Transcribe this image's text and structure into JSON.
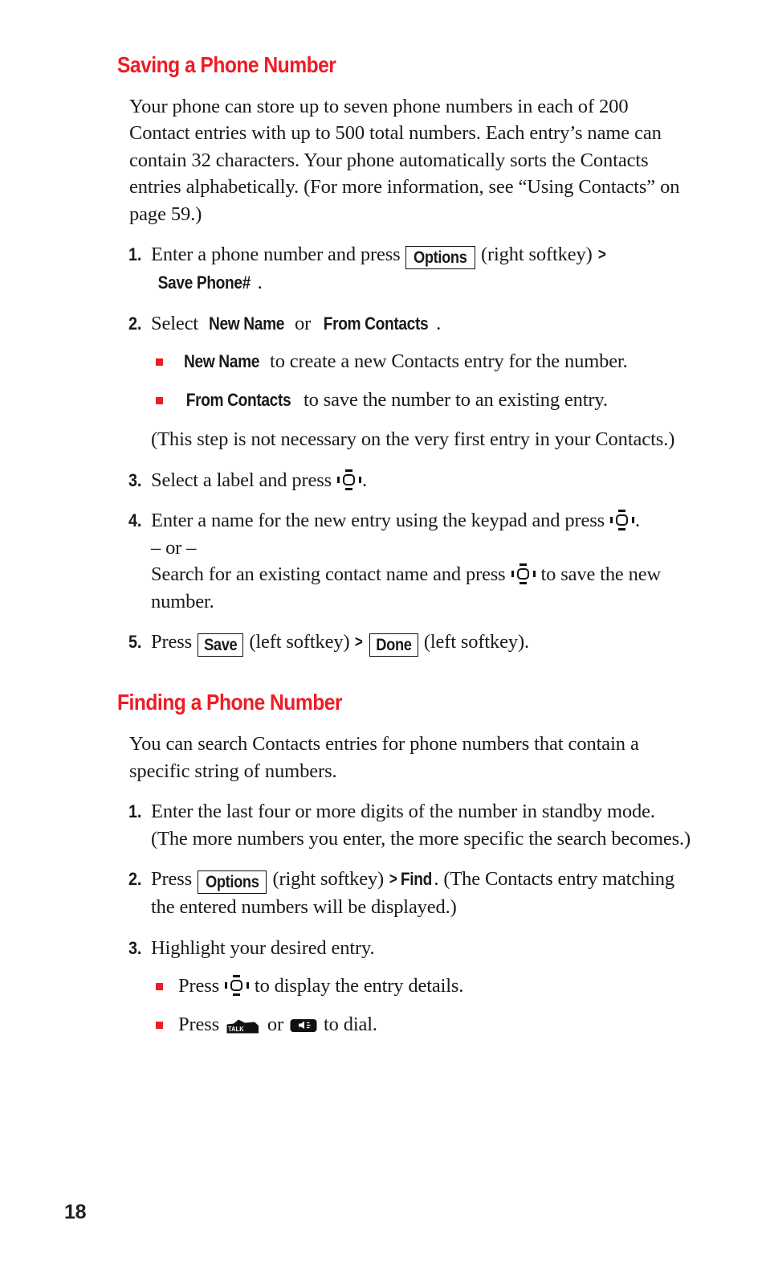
{
  "page": {
    "number": "18",
    "accent_color": "#ee1c25",
    "text_color": "#1a1a1a"
  },
  "sections": [
    {
      "heading": "Saving a Phone Number",
      "intro": "Your phone can store up to seven phone numbers in each of 200 Contact entries with up to 500 total numbers. Each entry’s name can contain 32 characters. Your phone automatically sorts the Contacts entries alphabetically. (For more information, see “Using Contacts” on page 59.)",
      "steps": [
        {
          "num": "1.",
          "t1": "Enter a phone number and press ",
          "softkey": "Options",
          "t2": " (right softkey) ",
          "arrow": ">",
          "bold_target": "Save Phone#",
          "t3": "."
        },
        {
          "num": "2.",
          "t1": "Select ",
          "b1": "New Name",
          "t2": " or ",
          "b2": "From Contacts",
          "t3": ".",
          "bullets": [
            {
              "bold": "New Name",
              "text": " to create a new Contacts entry for the number."
            },
            {
              "bold": "From Contacts",
              "text": " to save the number to an existing entry."
            }
          ],
          "note": "(This step is not necessary on the very first entry in your Contacts.)"
        },
        {
          "num": "3.",
          "t1": "Select a label and press ",
          "icon": "navigation-key-icon",
          "t2": "."
        },
        {
          "num": "4.",
          "t1": "Enter a name for the new entry using the keypad and press ",
          "icon": "navigation-key-icon",
          "t2": ".",
          "or_label": "– or –",
          "alt_t1": "Search for an existing contact name and press ",
          "alt_icon": "navigation-key-icon",
          "alt_t2": " to save the new number."
        },
        {
          "num": "5.",
          "t1": "Press ",
          "softkey1": "Save",
          "t2": " (left softkey) ",
          "arrow": ">",
          "softkey2": "Done",
          "t3": " (left softkey)."
        }
      ]
    },
    {
      "heading": "Finding a Phone Number",
      "intro": "You can search Contacts entries for phone numbers that contain a specific string of numbers.",
      "steps": [
        {
          "num": "1.",
          "t1": "Enter the last four or more digits of the number in standby mode. (The more numbers you enter, the more specific the search becomes.)"
        },
        {
          "num": "2.",
          "t1": "Press ",
          "softkey": "Options",
          "t2": " (right softkey) ",
          "arrow": ">",
          "bold_target": "Find",
          "t3": ". (The Contacts entry matching the entered numbers will be displayed.)"
        },
        {
          "num": "3.",
          "t1": "Highlight your desired entry.",
          "bullets": [
            {
              "pre": "Press ",
              "icon": "navigation-key-icon",
              "post": " to display the entry details."
            },
            {
              "pre": "Press ",
              "icon": "talk-key-icon",
              "mid": " or ",
              "icon2": "speaker-key-icon",
              "post": " to dial."
            }
          ]
        }
      ]
    }
  ],
  "icons": {
    "talk_label": "TALK"
  }
}
